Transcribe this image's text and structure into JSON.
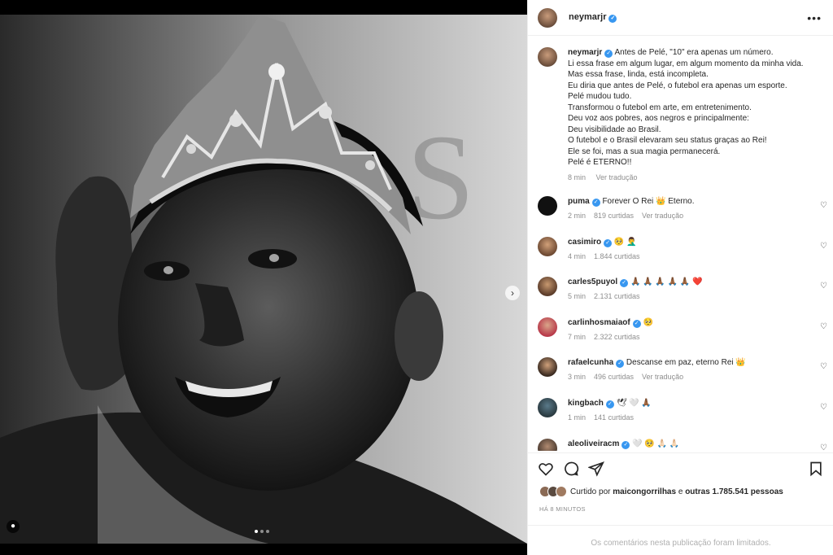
{
  "post": {
    "username": "neymarjr",
    "more_icon": "more-icon",
    "caption_lines": [
      "Antes de Pelé, \"10\" era apenas um número.",
      "Li essa frase em algum lugar, em algum momento da minha vida.",
      "Mas essa frase, linda, está incompleta.",
      "Eu diria que antes de Pelé, o futebol era apenas um esporte.",
      "Pelé mudou tudo.",
      "Transformou o futebol em arte, em entretenimento.",
      "Deu voz aos pobres, aos negros e principalmente:",
      "Deu visibilidade ao Brasil.",
      "O futebol e o Brasil elevaram seu status graças ao Rei!",
      "Ele se foi, mas a sua magia permanecerá.",
      "Pelé é ETERNO!!"
    ],
    "caption_time": "8 min",
    "caption_translate": "Ver tradução"
  },
  "comments": [
    {
      "user": "puma",
      "text": "Forever O Rei 👑 Eterno.",
      "time": "2 min",
      "likes": "819 curtidas",
      "translate": "Ver tradução"
    },
    {
      "user": "casimiro",
      "text": "🥺 🤦‍♂️",
      "time": "4 min",
      "likes": "1.844 curtidas",
      "translate": ""
    },
    {
      "user": "carles5puyol",
      "text": "🙏🏾 🙏🏾 🙏🏾 🙏🏾 🙏🏾 ❤️",
      "time": "5 min",
      "likes": "2.131 curtidas",
      "translate": ""
    },
    {
      "user": "carlinhosmaiaof",
      "text": "🥺",
      "time": "7 min",
      "likes": "2.322 curtidas",
      "translate": ""
    },
    {
      "user": "rafaelcunha",
      "text": "Descanse em paz, eterno Rei 👑",
      "time": "3 min",
      "likes": "496 curtidas",
      "translate": "Ver tradução"
    },
    {
      "user": "kingbach",
      "text": "🕊 🤍 🙏🏾",
      "time": "1 min",
      "likes": "141 curtidas",
      "translate": ""
    },
    {
      "user": "aleoliveiracm",
      "text": "🤍 🥺 🙏🏻 🙏🏻",
      "time": "",
      "likes": "",
      "translate": ""
    }
  ],
  "likes": {
    "prefix": "Curtido por",
    "user": "maicongorrilhas",
    "middle": "e",
    "others": "outras 1.785.541 pessoas"
  },
  "time_ago": "HÁ 8 MINUTOS",
  "limited": "Os comentários nesta publicação foram limitados.",
  "carousel": {
    "current": 1,
    "total": 3
  }
}
